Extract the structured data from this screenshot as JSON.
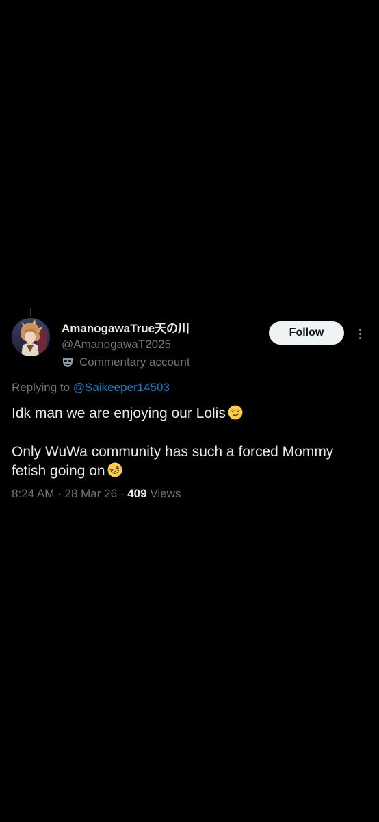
{
  "tweet": {
    "author": {
      "display_name": "AmanogawaTrue天の川",
      "handle": "@AmanogawaT2025",
      "label": "Commentary account",
      "label_icon": "theater-mask-icon",
      "avatar": "avatar"
    },
    "follow_label": "Follow",
    "more_icon": "more-vertical-icon",
    "replying_prefix": "Replying to",
    "replying_to": "@Saikeeper14503",
    "text_line1": "Idk man we are enjoying our Lolis",
    "text_line1_emoji": "smirking-face-emoji",
    "text_line2": "Only WuWa community has such a forced Mommy fetish going on",
    "text_line2_emoji": "rofl-emoji",
    "time": "8:24 AM",
    "date": "28 Mar 26",
    "views_count": "409",
    "views_label": "Views",
    "separator": "·"
  },
  "colors": {
    "background": "#000000",
    "primary_text": "#e7e9ea",
    "secondary_text": "#71767b",
    "link": "#1d9bf0",
    "follow_bg": "#eff3f4",
    "follow_text": "#0f1419"
  }
}
